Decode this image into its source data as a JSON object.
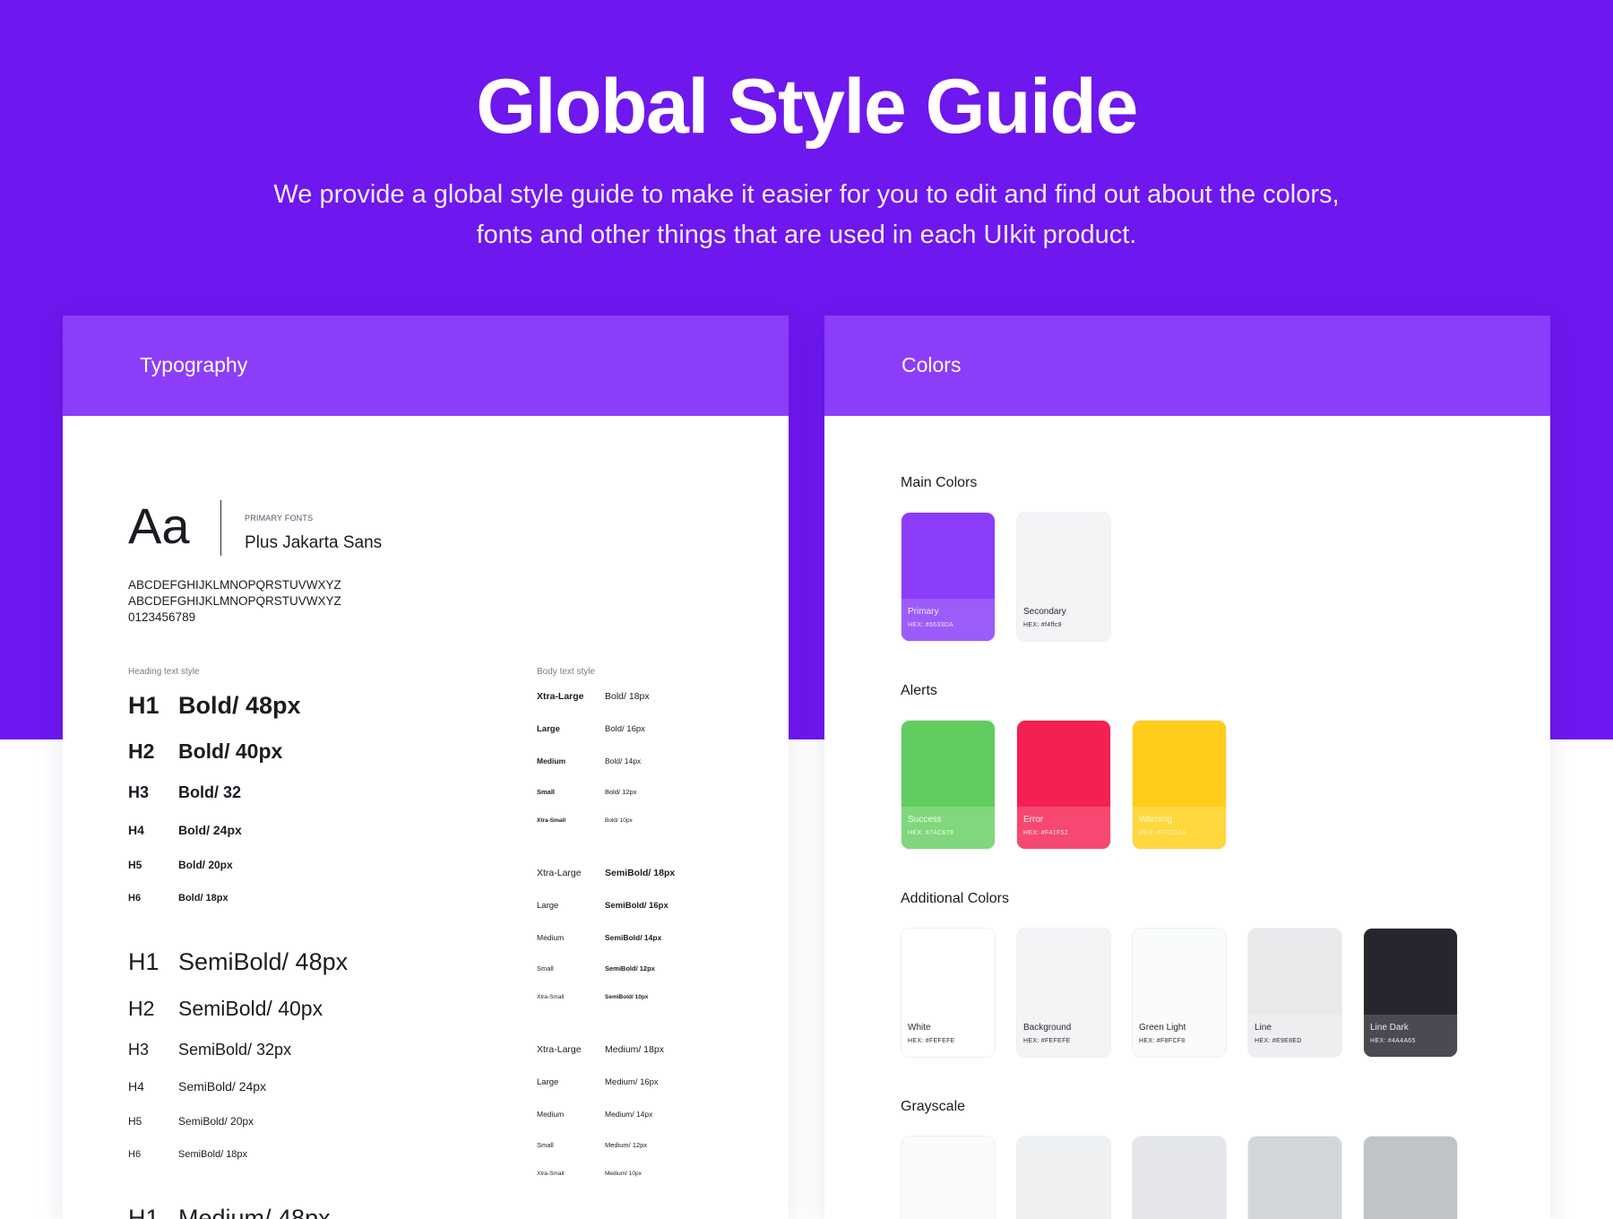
{
  "hero": {
    "title": "Global Style Guide",
    "subtitle_line1": "We provide a global style guide to make it easier for you to edit and find out about the colors,",
    "subtitle_line2": "fonts and other things that are used in each UIkit product."
  },
  "typography": {
    "header": "Typography",
    "sample": "Aa",
    "primary_fonts_label": "PRIMARY FONTS",
    "font_name": "Plus Jakarta Sans",
    "alphabet_upper": "ABCDEFGHIJKLMNOPQRSTUVWXYZ",
    "alphabet_lower": "ABCDEFGHIJKLMNOPQRSTUVWXYZ",
    "digits": "0123456789",
    "heading_label": "Heading text style",
    "body_label": "Body text style",
    "headings": [
      {
        "tag": "H1",
        "style": "Bold/ 48px"
      },
      {
        "tag": "H2",
        "style": "Bold/ 40px"
      },
      {
        "tag": "H3",
        "style": "Bold/ 32"
      },
      {
        "tag": "H4",
        "style": "Bold/ 24px"
      },
      {
        "tag": "H5",
        "style": "Bold/ 20px"
      },
      {
        "tag": "H6",
        "style": "Bold/ 18px"
      },
      {
        "tag": "H1",
        "style": "SemiBold/ 48px"
      },
      {
        "tag": "H2",
        "style": "SemiBold/ 40px"
      },
      {
        "tag": "H3",
        "style": "SemiBold/ 32px"
      },
      {
        "tag": "H4",
        "style": "SemiBold/ 24px"
      },
      {
        "tag": "H5",
        "style": "SemiBold/ 20px"
      },
      {
        "tag": "H6",
        "style": "SemiBold/ 18px"
      },
      {
        "tag": "H1",
        "style": "Medium/ 48px"
      }
    ],
    "body": [
      {
        "size": "Xtra-Large",
        "style": "Bold/ 18px"
      },
      {
        "size": "Large",
        "style": "Bold/ 16px"
      },
      {
        "size": "Medium",
        "style": "Bold/ 14px"
      },
      {
        "size": "Small",
        "style": "Bold/ 12px"
      },
      {
        "size": "Xtra-Small",
        "style": "Bold/ 10px"
      },
      {
        "size": "Xtra-Large",
        "style": "SemiBold/ 18px"
      },
      {
        "size": "Large",
        "style": "SemiBold/ 16px"
      },
      {
        "size": "Medium",
        "style": "SemiBold/ 14px"
      },
      {
        "size": "Small",
        "style": "SemiBold/ 12px"
      },
      {
        "size": "Xtra-Small",
        "style": "SemiBold/ 10px"
      },
      {
        "size": "Xtra-Large",
        "style": "Medium/ 18px"
      },
      {
        "size": "Large",
        "style": "Medium/ 16px"
      },
      {
        "size": "Medium",
        "style": "Medium/ 14px"
      },
      {
        "size": "Small",
        "style": "Medium/ 12px"
      },
      {
        "size": "Xtra-Small",
        "style": "Medium/ 10px"
      }
    ]
  },
  "colors": {
    "header": "Colors",
    "main_title": "Main Colors",
    "alerts_title": "Alerts",
    "additional_title": "Additional Colors",
    "grayscale_title": "Grayscale",
    "main": [
      {
        "name": "Primary",
        "hex": "HEX: #6633DA",
        "top": "#8b3dfa",
        "bottom": "#9c5cf9",
        "text": "#f1e6ff"
      },
      {
        "name": "Secondary",
        "hex": "HEX: #f4ffc9",
        "top": "#f4f4f6",
        "bottom": "#f4f4f6",
        "text": "#2a2a33"
      }
    ],
    "alerts": [
      {
        "name": "Success",
        "hex": "HEX: #7AC678",
        "top": "#62cc5e",
        "bottom": "#80d77d",
        "text": "#eaffe9"
      },
      {
        "name": "Error",
        "hex": "HEX: #F41F52",
        "top": "#f41f52",
        "bottom": "#f64870",
        "text": "#ffe8ee"
      },
      {
        "name": "Warning",
        "hex": "HEX: #FFCD1A",
        "top": "#ffcd1a",
        "bottom": "#ffd83f",
        "text": "#fff4c4"
      }
    ],
    "additional": [
      {
        "name": "White",
        "hex": "HEX: #FEFEFE",
        "top": "#ffffff",
        "bottom": "#ffffff",
        "text": "#2a2a33"
      },
      {
        "name": "Background",
        "hex": "HEX: #FEFEFE",
        "top": "#f4f4f6",
        "bottom": "#f4f4f6",
        "text": "#2a2a33"
      },
      {
        "name": "Green Light",
        "hex": "HEX: #F8FCF8",
        "top": "#f8fbf8",
        "bottom": "#f8fbf8",
        "text": "#2a2a33"
      },
      {
        "name": "Line",
        "hex": "HEX: #E9E8ED",
        "top": "#e9e9ec",
        "bottom": "#eeeef1",
        "text": "#2a2a33"
      },
      {
        "name": "Line Dark",
        "hex": "HEX: #4A4A65",
        "top": "#27262f",
        "bottom": "#4a4a52",
        "text": "#e8e8f0"
      }
    ],
    "grayscale": [
      {
        "top": "#fafafb"
      },
      {
        "top": "#eef0f2"
      },
      {
        "top": "#e4e6e9"
      },
      {
        "top": "#d2d6da"
      },
      {
        "top": "#bfc4c9"
      }
    ]
  }
}
